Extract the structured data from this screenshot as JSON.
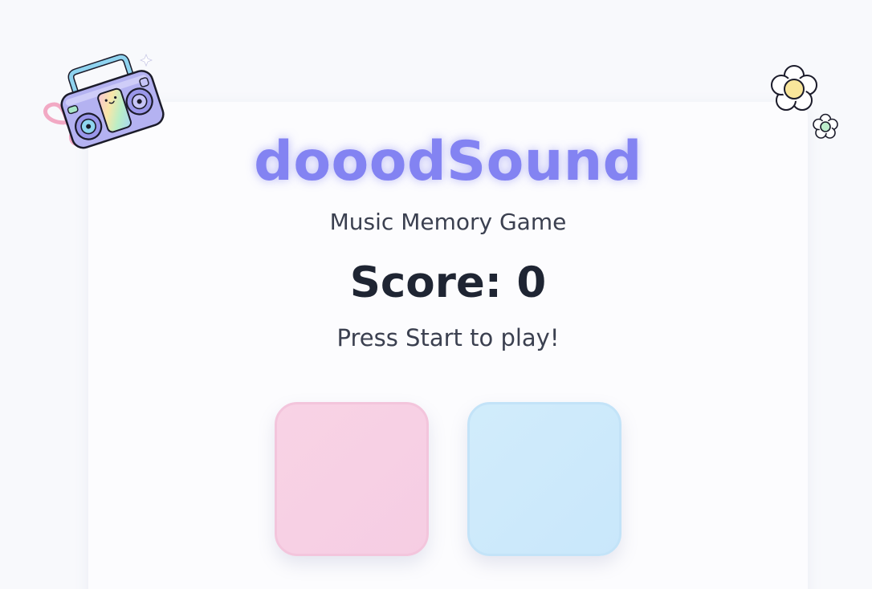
{
  "game": {
    "title": "dooodSound",
    "subtitle": "Music Memory Game",
    "score_text": "Score: 0",
    "status_text": "Press Start to play!"
  },
  "pads": [
    {
      "name": "pink-pad",
      "color": "#f7d0e4"
    },
    {
      "name": "blue-pad",
      "color": "#cde9fb"
    }
  ],
  "decorations": {
    "boombox_icon": "boombox-icon",
    "flower_icon": "flower-icon"
  },
  "colors": {
    "accent": "#8383f2",
    "background": "#f8f9fc",
    "card": "#fcfcfe",
    "text_dark": "#1f2533",
    "text_muted": "#3b4050"
  }
}
